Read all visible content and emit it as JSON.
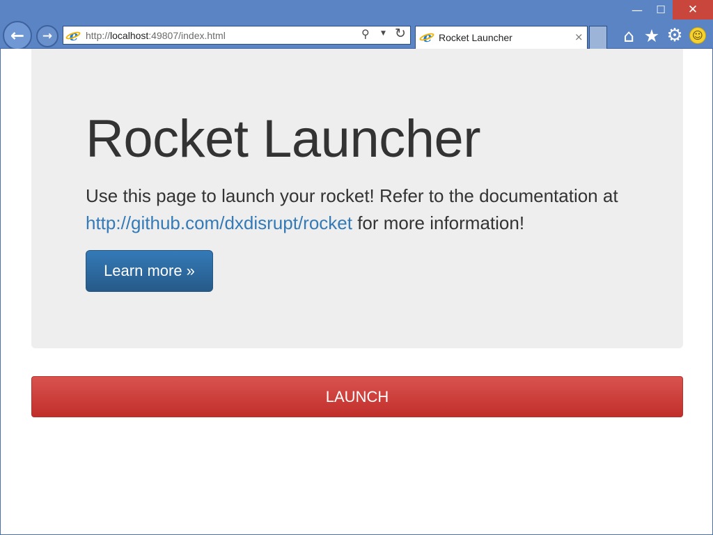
{
  "window": {
    "minimize_icon": "minimize-icon",
    "maximize_icon": "maximize-icon",
    "close_icon": "close-icon",
    "minimize_glyph": "—",
    "maximize_glyph": "☐",
    "close_glyph": "✕"
  },
  "nav": {
    "back_glyph": "←",
    "forward_glyph": "→"
  },
  "address": {
    "url_prefix": "http://",
    "url_host": "localhost",
    "url_rest": ":49807/index.html",
    "search_glyph": "⚲",
    "dropdown_glyph": "▼",
    "refresh_glyph": "↻"
  },
  "tab": {
    "title": "Rocket Launcher",
    "close_glyph": "×"
  },
  "toolbar": {
    "home_glyph": "⌂",
    "favorites_glyph": "★",
    "settings_glyph": "⚙",
    "feedback_glyph": "☺"
  },
  "page": {
    "title": "Rocket Launcher",
    "description_before": "Use this page to launch your rocket! Refer to the documentation at ",
    "doc_link": "http://github.com/dxdisrupt/rocket",
    "description_after": " for more information!",
    "learn_more_label": "Learn more »",
    "launch_label": "LAUNCH"
  },
  "colors": {
    "chrome": "#5b84c4",
    "close_button": "#c9463d",
    "jumbotron_bg": "#eeeeee",
    "primary_button": "#337ab7",
    "danger_button": "#d9534f",
    "link": "#337ab7"
  }
}
